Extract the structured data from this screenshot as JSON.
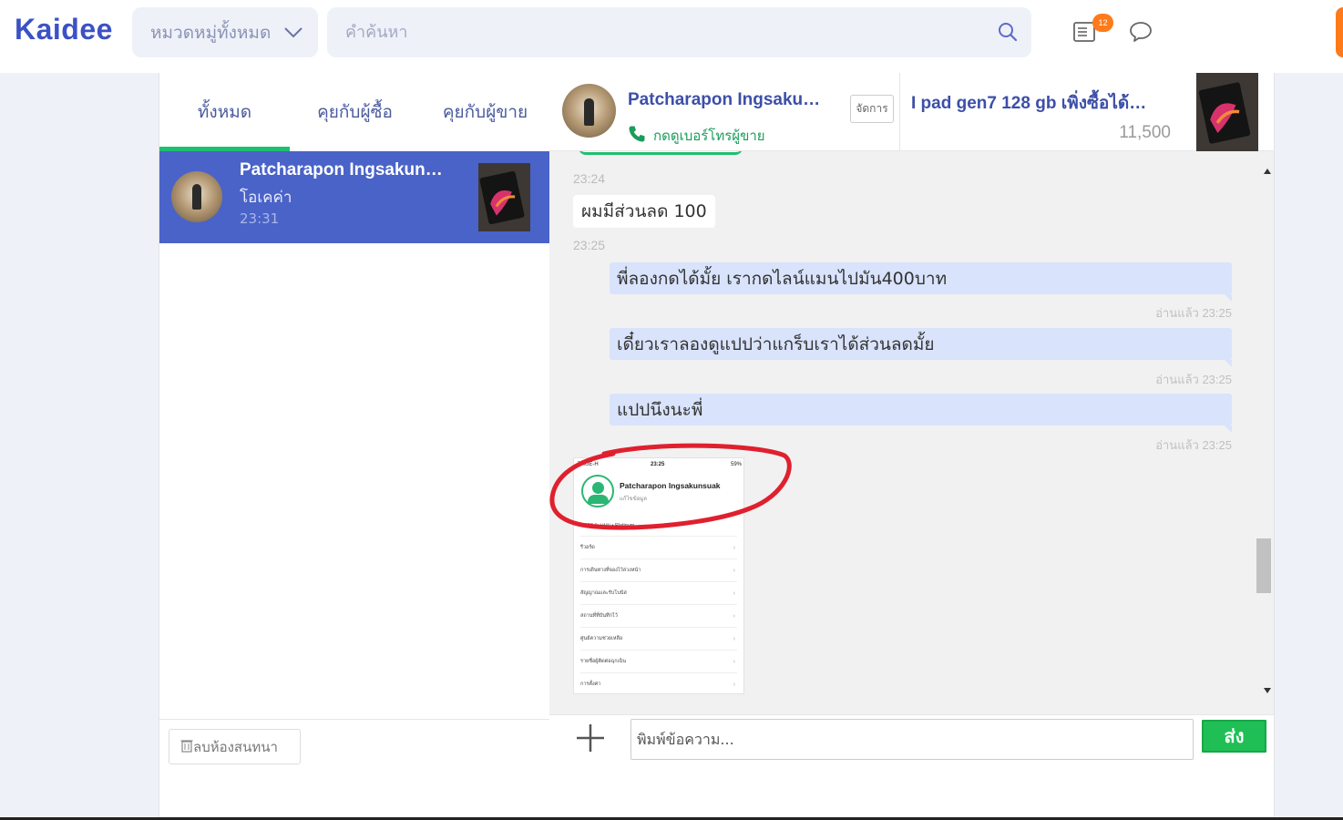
{
  "header": {
    "logo": "Kaidee",
    "category_select": "หมวดหมู่ทั้งหมด",
    "search_placeholder": "คำค้นหา",
    "notification_count": "12"
  },
  "sidebar": {
    "tabs": [
      {
        "label": "ทั้งหมด",
        "active": true
      },
      {
        "label": "คุยกับผู้ซื้อ",
        "active": false
      },
      {
        "label": "คุยกับผู้ขาย",
        "active": false
      }
    ],
    "conversation": {
      "name": "Patcharapon Ingsakun…",
      "last_message": "โอเคค่า",
      "time": "23:31"
    },
    "delete_label": "ลบห้องสนทนา"
  },
  "chat": {
    "header": {
      "name": "Patcharapon Ingsaku…",
      "manage_label": "จัดการ",
      "phone_label": "กดดูเบอร์โทรผู้ขาย",
      "product_title": "I pad gen7 128 gb เพิ่งซื้อได้…",
      "product_price": "11,500"
    },
    "messages": [
      {
        "type": "timestamp",
        "text": "23:24"
      },
      {
        "type": "incoming",
        "text": "ผมมีส่วนลด 100"
      },
      {
        "type": "timestamp",
        "text": "23:25"
      },
      {
        "type": "outgoing",
        "text": "พี่ลองกดได้มั้ย เรากดไลน์แมนไปมัน400บาท",
        "status": "อ่านแล้ว 23:25"
      },
      {
        "type": "outgoing",
        "text": "เดี๋ยวเราลองดูแปปว่าแกร็บเราได้ส่วนลดมั้ย",
        "status": "อ่านแล้ว 23:25"
      },
      {
        "type": "outgoing",
        "text": "แปปนึงนะพี่",
        "status": "อ่านแล้ว 23:25"
      }
    ],
    "image_message": {
      "carrier": "TRUE-H",
      "clock": "23:25",
      "battery": "59%",
      "profile_name": "Patcharapon Ingsakunsuak",
      "profile_sub": "แก้ไขข้อมูล",
      "points": "3,128 คะแนน • Platinum",
      "menu_items": [
        "รีวอร์ด",
        "การเดินทางที่จองไว้ล่วงหน้า",
        "สัญญาณและรับโบนัส",
        "สถานที่ที่บันทึกไว้",
        "ศูนย์ความช่วยเหลือ",
        "รายชื่อผู้ติดต่อฉุกเฉิน",
        "การตั้งค่า"
      ]
    },
    "composer": {
      "placeholder": "พิมพ์ข้อความ...",
      "send_label": "ส่ง"
    }
  },
  "colors": {
    "brand": "#3b51c5",
    "selected_conversation": "#4a63c8",
    "outgoing_bubble": "#d9e3fb",
    "send_button": "#1fbf56",
    "notification_badge": "#ff7a1a",
    "annotation_circle": "#e0202e"
  },
  "icons": [
    "chevron-down-icon",
    "search-icon",
    "listing-icon",
    "chat-icon",
    "phone-icon",
    "plus-icon",
    "trash-icon",
    "scroll-up-icon",
    "scroll-down-icon"
  ]
}
